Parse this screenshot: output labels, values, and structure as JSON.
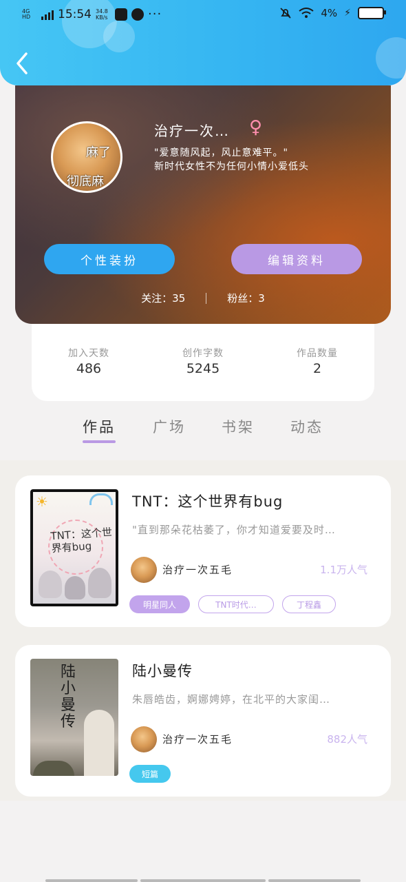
{
  "status_bar": {
    "network": "4G HD",
    "time": "15:54",
    "speed": "34.8 KB/s",
    "more": "···",
    "battery": "4%"
  },
  "profile": {
    "avatar_caption_top": "麻了",
    "avatar_caption_bottom": "彻底麻",
    "name": "治疗一次…",
    "gender_symbol": "♀",
    "bio_line1": "\"爱意随风起，风止意难平。\"",
    "bio_line2": "新时代女性不为任何小情小爱低头",
    "buttons": {
      "outfit": "个性装扮",
      "edit": "编辑资料"
    },
    "following_label": "关注：35",
    "followers_label": "粉丝：3"
  },
  "stats": [
    {
      "label": "加入天数",
      "value": "486"
    },
    {
      "label": "创作字数",
      "value": "5245"
    },
    {
      "label": "作品数量",
      "value": "2"
    }
  ],
  "tabs": [
    {
      "label": "作品",
      "active": true
    },
    {
      "label": "广场",
      "active": false
    },
    {
      "label": "书架",
      "active": false
    },
    {
      "label": "动态",
      "active": false
    }
  ],
  "works": [
    {
      "title": "TNT：这个世界有bug",
      "cover_text": "TNT：这个世界有bug",
      "description": "\"直到那朵花枯萎了，你才知道爱要及时…",
      "author": "治疗一次五毛",
      "popularity": "1.1万人气",
      "tags": [
        "明星同人",
        "TNT时代…",
        "丁程鑫"
      ]
    },
    {
      "title": "陆小曼传",
      "cover_text": "陆小曼传",
      "description": "朱唇皓齿，婀娜娉婷，在北平的大家闺…",
      "author": "治疗一次五毛",
      "popularity": "882人气",
      "tags": [
        "短篇"
      ]
    }
  ],
  "colors": {
    "header_blue": "#36b6f2",
    "accent_purple": "#b999e4",
    "button_blue": "#2fa6f0",
    "tag_blue": "#45c8ee"
  }
}
